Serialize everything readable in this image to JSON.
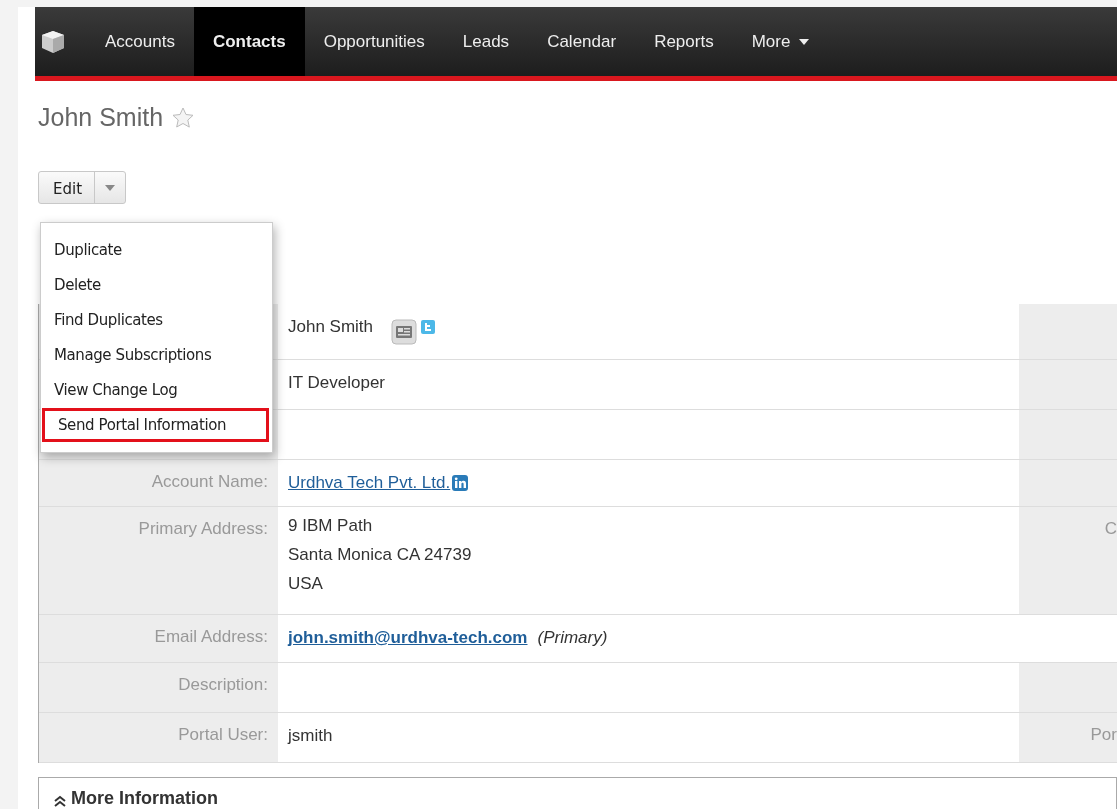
{
  "nav": {
    "items": [
      {
        "label": "Accounts",
        "selected": false
      },
      {
        "label": "Contacts",
        "selected": true
      },
      {
        "label": "Opportunities",
        "selected": false
      },
      {
        "label": "Leads",
        "selected": false
      },
      {
        "label": "Calendar",
        "selected": false
      },
      {
        "label": "Reports",
        "selected": false
      }
    ],
    "more": "More"
  },
  "record": {
    "title": "John Smith",
    "favorite": false
  },
  "actions": {
    "button": "Edit",
    "menu": [
      {
        "label": "Duplicate",
        "highlighted": false
      },
      {
        "label": "Delete",
        "highlighted": false
      },
      {
        "label": "Find Duplicates",
        "highlighted": false
      },
      {
        "label": "Manage Subscriptions",
        "highlighted": false
      },
      {
        "label": "View Change Log",
        "highlighted": false
      },
      {
        "label": "Send Portal Information",
        "highlighted": true
      }
    ]
  },
  "rows": [
    {
      "kind": "name",
      "value": "John Smith"
    },
    {
      "kind": "text",
      "value": "IT Developer"
    },
    {
      "kind": "blank"
    },
    {
      "kind": "link",
      "label": "Account Name:",
      "value": "Urdhva Tech Pvt. Ltd."
    },
    {
      "kind": "address",
      "label": "Primary Address:",
      "lines": [
        "9 IBM Path",
        "Santa Monica CA  24739",
        "USA"
      ],
      "side_label": "C"
    },
    {
      "kind": "email",
      "label": "Email Address:",
      "value": "john.smith@urdhva-tech.com",
      "note": "(Primary)"
    },
    {
      "kind": "text",
      "label": "Description:"
    },
    {
      "kind": "text",
      "label": "Portal User:",
      "value": "jsmith",
      "side_label": "Por"
    }
  ],
  "panel": {
    "title": "More Information",
    "expanded": true
  }
}
